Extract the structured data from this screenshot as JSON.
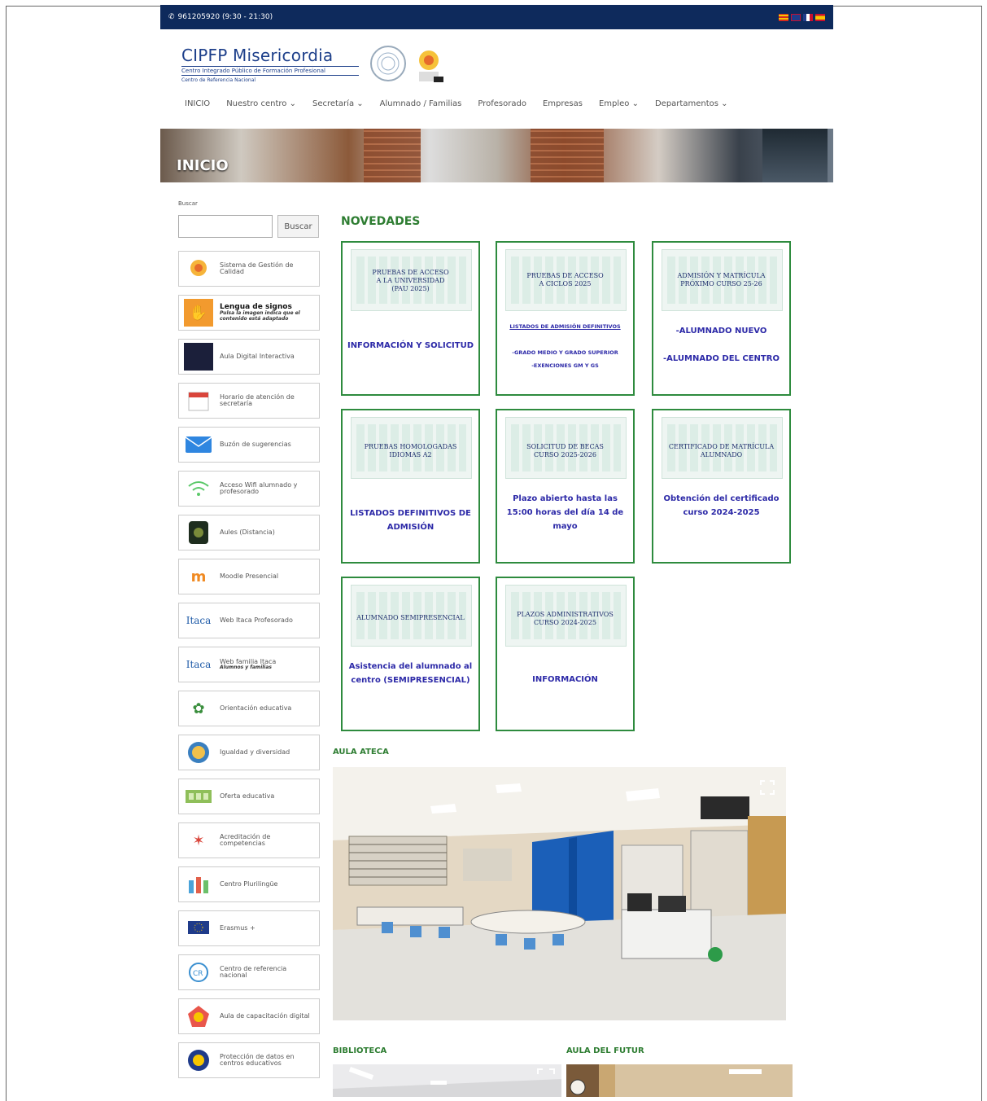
{
  "topbar": {
    "phone": "961205920 (9:30 - 21:30)",
    "flags": [
      "valencian-flag",
      "uk-flag",
      "france-flag",
      "spain-flag"
    ]
  },
  "header": {
    "logo_title": "CIPFP Misericordia",
    "logo_subtitle": "Centro Integrado Público de Formación Profesional",
    "logo_tagline": "Centro de Referencia Nacional"
  },
  "nav": {
    "items": [
      "INICIO",
      "Nuestro centro ⌄",
      "Secretaría ⌄",
      "Alumnado / Familias",
      "Profesorado",
      "Empresas",
      "Empleo ⌄",
      "Departamentos ⌄"
    ]
  },
  "hero": {
    "title": "INICIO"
  },
  "sidebar": {
    "search_label": "Buscar",
    "search_button": "Buscar",
    "items": [
      {
        "label": "Sistema de Gestión de Calidad",
        "icon": "quality-icon"
      },
      {
        "label": "Lengua de signos",
        "note": "Pulsa la imagen indica que el contenido está adaptado",
        "icon": "sign-language-icon"
      },
      {
        "label": "Aula Digital Interactiva",
        "icon": "digital-classroom-icon"
      },
      {
        "label": "Horario de atención de secretaría",
        "icon": "calendar-icon"
      },
      {
        "label": "Buzón de sugerencias",
        "icon": "mail-icon"
      },
      {
        "label": "Acceso Wifi alumnado y profesorado",
        "icon": "wifi-icon"
      },
      {
        "label": "Aules (Distancia)",
        "icon": "aules-icon"
      },
      {
        "label": "Moodle Presencial",
        "icon": "moodle-icon"
      },
      {
        "label": "Web Itaca Profesorado",
        "icon": "itaca-icon"
      },
      {
        "label": "Web familia Itaca",
        "note": "Alumnos y familias",
        "icon": "itaca-family-icon"
      },
      {
        "label": "Orientación educativa",
        "icon": "orientation-icon"
      },
      {
        "label": "Igualdad y diversidad",
        "icon": "equality-icon"
      },
      {
        "label": "Oferta educativa",
        "icon": "education-offer-icon"
      },
      {
        "label": "Acreditación de competencias",
        "icon": "accreditation-icon"
      },
      {
        "label": "Centro Plurilingüe",
        "icon": "plurilingual-icon"
      },
      {
        "label": "Erasmus +",
        "icon": "erasmus-icon"
      },
      {
        "label": "Centro de referencia nacional",
        "icon": "crn-icon"
      },
      {
        "label": "Aula de capacitación digital",
        "icon": "digital-training-icon"
      },
      {
        "label": "Protección de datos en centros educativos",
        "icon": "data-protection-icon"
      }
    ]
  },
  "novedades": {
    "title": "NOVEDADES",
    "cards": [
      {
        "thumb": "PRUEBAS DE ACCESO\nA LA UNIVERSIDAD\n(PAU 2025)",
        "links": [
          "INFORMACIÓN Y SOLICITUD"
        ]
      },
      {
        "thumb": "PRUEBAS DE ACCESO\nA CICLOS 2025",
        "links": [
          "LISTADOS DE ADMISIÓN DEFINITIVOS",
          "-GRADO MEDIO Y GRADO SUPERIOR",
          "-EXENCIONES GM Y GS"
        ]
      },
      {
        "thumb": "ADMISIÓN Y MATRÍCULA\nPRÓXIMO CURSO 25-26",
        "links": [
          "-ALUMNADO NUEVO",
          "-ALUMNADO DEL CENTRO"
        ]
      },
      {
        "thumb": "PRUEBAS HOMOLOGADAS\nIDIOMAS A2",
        "links": [
          "LISTADOS DEFINITIVOS DE ADMISIÓN"
        ]
      },
      {
        "thumb": "SOLICITUD DE BECAS\nCURSO 2025-2026",
        "links": [
          "Plazo abierto hasta las 15:00 horas del día 14 de mayo"
        ]
      },
      {
        "thumb": "CERTIFICADO DE MATRÍCULA\nALUMNADO",
        "links": [
          "Obtención del certificado curso 2024-2025"
        ]
      },
      {
        "thumb": "ALUMNADO SEMIPRESENCIAL",
        "links": [
          "Asistencia del alumnado al centro (SEMIPRESENCIAL)"
        ]
      },
      {
        "thumb": "PLAZOS ADMINISTRATIVOS\nCURSO 2024-2025",
        "links": [
          "INFORMACIÓN"
        ]
      }
    ]
  },
  "sections": {
    "aula_ateca": "AULA ATECA",
    "biblioteca": "BIBLIOTECA",
    "aula_futur": "AULA DEL FUTUR"
  }
}
